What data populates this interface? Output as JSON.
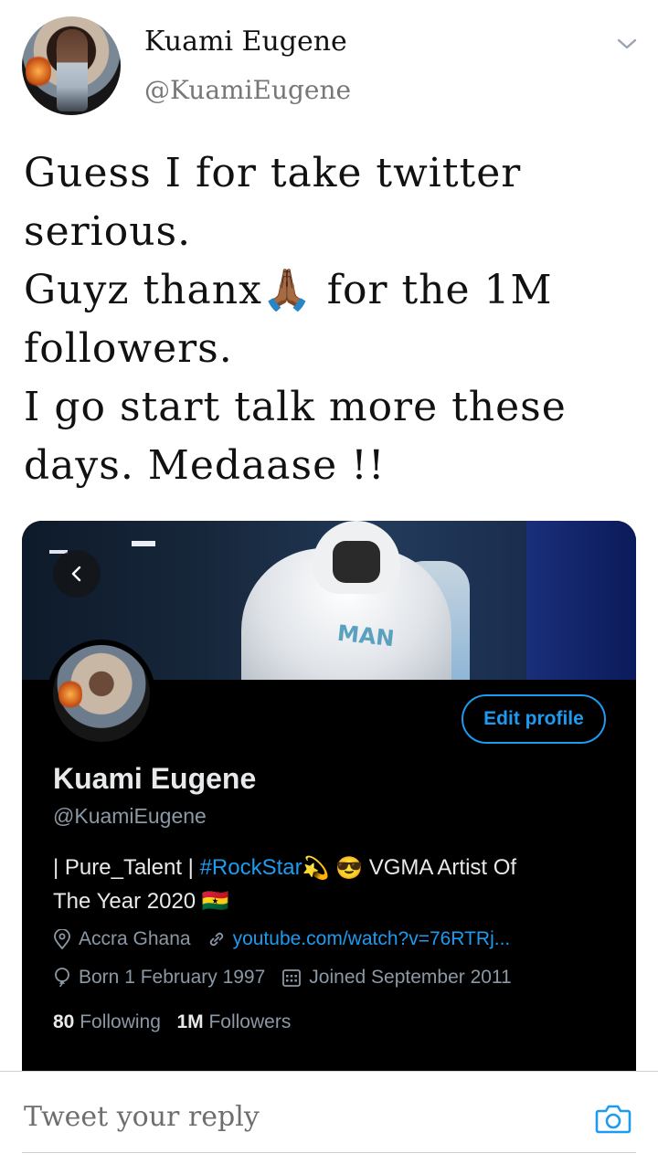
{
  "tweet": {
    "author_name": "Kuami Eugene",
    "author_handle": "@KuamiEugene",
    "text_lines": [
      "Guess I for take twitter",
      "serious.",
      "Guyz thanx🙏🏾 for the 1M",
      "followers.",
      "I go start talk more these",
      "days. Medaase !!"
    ]
  },
  "profile_card": {
    "edit_profile_label": "Edit profile",
    "name": "Kuami Eugene",
    "handle": "@KuamiEugene",
    "bio_prefix": "| Pure_Talent | ",
    "bio_hashtag": "#RockStar",
    "bio_emoji_1": "💫",
    "bio_emoji_2": "😎",
    "bio_middle": " VGMA Artist Of",
    "bio_line2": "The Year 2020",
    "bio_flag": "🇬🇭",
    "banner_brand_text": "MAN",
    "location": "Accra Ghana",
    "website": "youtube.com/watch?v=76RTRj...",
    "birthday": "Born 1 February 1997",
    "joined": "Joined September 2011",
    "following_count": "80",
    "following_label": "Following",
    "followers_count": "1M",
    "followers_label": "Followers",
    "colors": {
      "accent": "#1d9bf0",
      "background": "#000000",
      "muted": "#8b98a5"
    }
  },
  "reply_bar": {
    "placeholder": "Tweet your reply"
  },
  "icons": [
    "chevron-down-icon",
    "back-arrow-icon",
    "location-pin-icon",
    "link-icon",
    "balloon-icon",
    "calendar-icon",
    "camera-icon"
  ]
}
